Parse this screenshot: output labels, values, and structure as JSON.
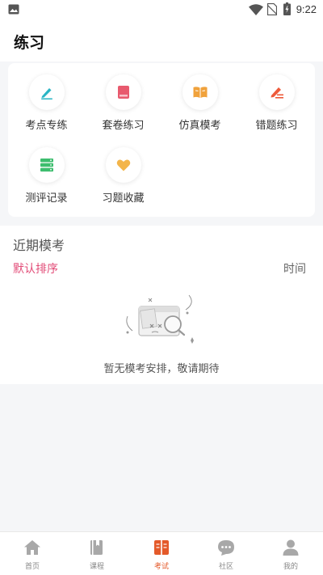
{
  "status_bar": {
    "time": "9:22",
    "icons": [
      "gallery-icon",
      "wifi-icon",
      "no-sim-icon",
      "battery-charging-icon"
    ]
  },
  "header": {
    "title": "练习"
  },
  "practice_grid": {
    "items": [
      {
        "label": "考点专练",
        "icon": "pen-icon",
        "color": "#2ab5c4"
      },
      {
        "label": "套卷练习",
        "icon": "book-icon",
        "color": "#e85a6e"
      },
      {
        "label": "仿真模考",
        "icon": "open-book-icon",
        "color": "#f0a23c"
      },
      {
        "label": "错题练习",
        "icon": "pencil-icon",
        "color": "#ee5a3a"
      },
      {
        "label": "测评记录",
        "icon": "server-icon",
        "color": "#3dbd6e"
      },
      {
        "label": "习题收藏",
        "icon": "heart-icon",
        "color": "#f3b54a"
      }
    ]
  },
  "recent_exams": {
    "title": "近期模考",
    "sort_label": "默认排序",
    "time_label": "时间",
    "empty_text": "暂无模考安排，敬请期待"
  },
  "tabbar": {
    "tabs": [
      {
        "label": "首页",
        "icon": "home-icon",
        "active": false
      },
      {
        "label": "课程",
        "icon": "course-book-icon",
        "active": false
      },
      {
        "label": "考试",
        "icon": "exam-icon",
        "active": true
      },
      {
        "label": "社区",
        "icon": "chat-icon",
        "active": false
      },
      {
        "label": "我的",
        "icon": "person-icon",
        "active": false
      }
    ]
  },
  "colors": {
    "accent": "#e24b77",
    "tab_active": "#e45a2a",
    "tab_inactive": "#a0a0a0"
  }
}
